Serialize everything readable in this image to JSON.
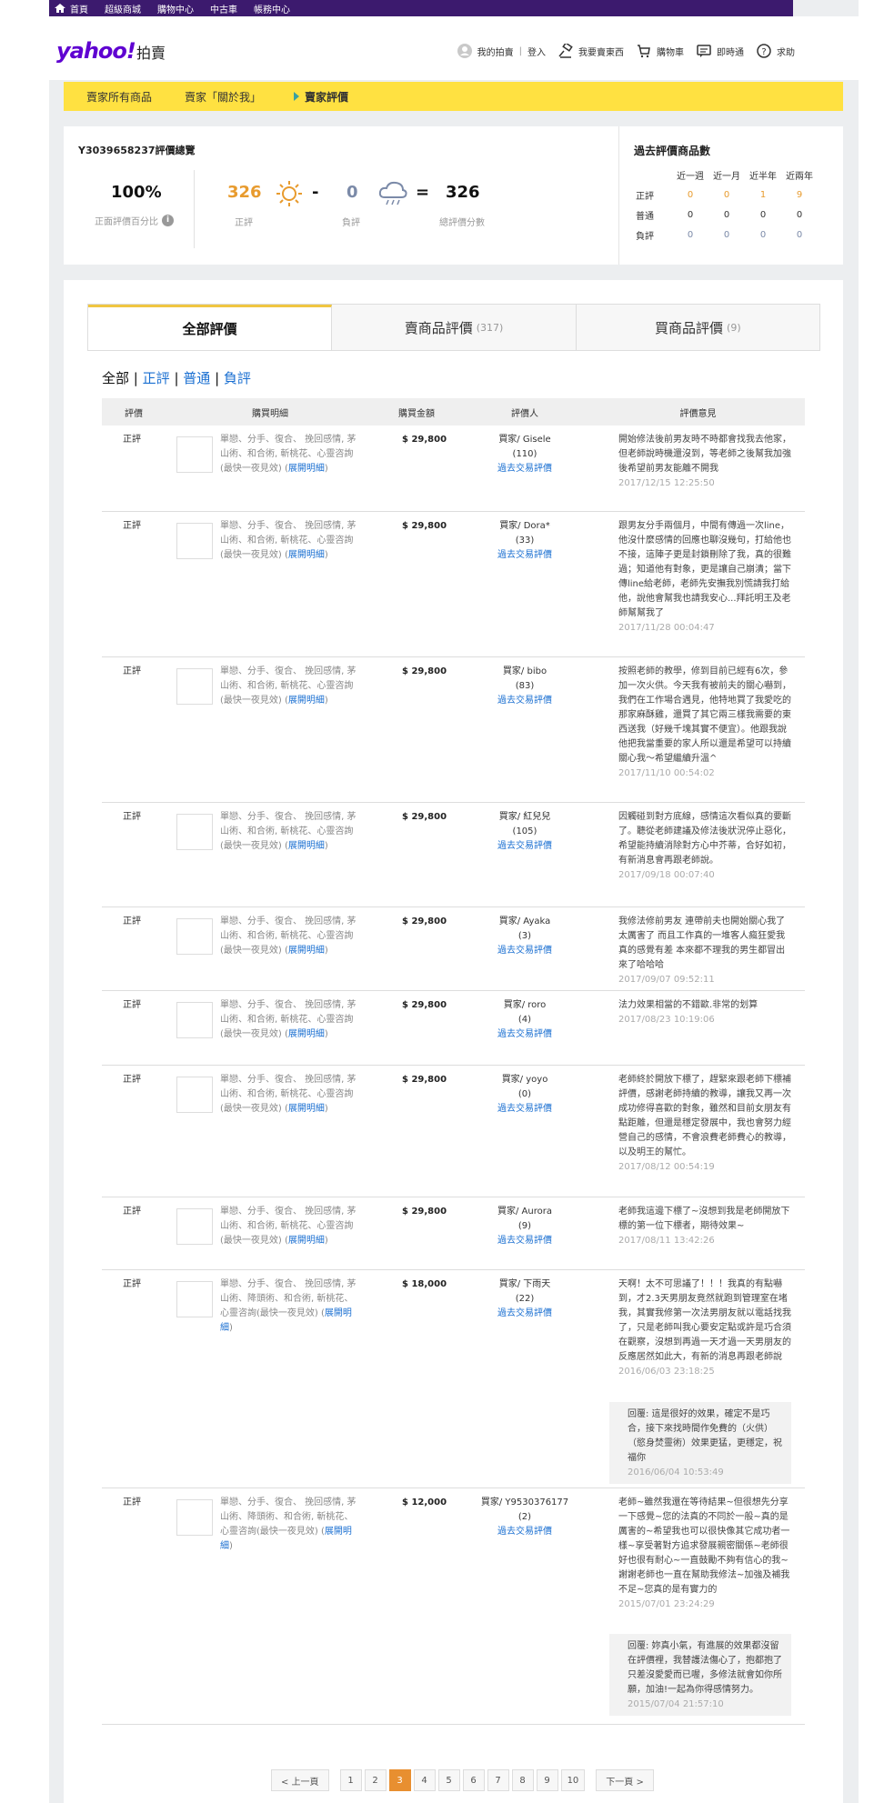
{
  "topbar": {
    "items": [
      "首頁",
      "超級商城",
      "購物中心",
      "中古車",
      "帳務中心"
    ]
  },
  "header": {
    "logo": "yahoo!",
    "logo_sub": "拍賣",
    "links": {
      "my_auction": "我的拍賣",
      "login": "登入",
      "sell": "我要賣東西",
      "cart": "購物車",
      "chat": "即時通",
      "help": "求助"
    }
  },
  "nav": {
    "items": [
      "賣家所有商品",
      "賣家「關於我」",
      "賣家評價"
    ]
  },
  "summary": {
    "title": "Y3039658237評價總覽",
    "percent": "100%",
    "percent_label": "正面評價百分比",
    "positive": "326",
    "positive_label": "正評",
    "negative": "0",
    "negative_label": "負評",
    "total": "326",
    "total_label": "總評價分數",
    "minus": "-",
    "equals": "="
  },
  "past": {
    "title": "過去評價商品數",
    "cols": [
      "近一週",
      "近一月",
      "近半年",
      "近兩年"
    ],
    "rows": [
      {
        "label": "正評",
        "values": [
          "0",
          "0",
          "1",
          "9"
        ]
      },
      {
        "label": "普通",
        "values": [
          "0",
          "0",
          "0",
          "0"
        ]
      },
      {
        "label": "負評",
        "values": [
          "0",
          "0",
          "0",
          "0"
        ]
      }
    ]
  },
  "tabs": [
    {
      "label": "全部評價",
      "count": ""
    },
    {
      "label": "賣商品評價",
      "count": "(317)"
    },
    {
      "label": "買商品評價",
      "count": "(9)"
    }
  ],
  "filter": {
    "all": "全部",
    "positive": "正評",
    "neutral": "普通",
    "negative": "負評",
    "sep": "|"
  },
  "table": {
    "headers": [
      "評價",
      "購買明細",
      "購買金額",
      "評價人",
      "評價意見"
    ],
    "rows": [
      {
        "rating": "正評",
        "desc": "單戀、分手、復合、 挽回感情, 茅山術、和合術, 斬桃花、心靈咨詢(最快一夜見效) (",
        "more": "展開明細",
        "close": ")",
        "price": "$ 29,800",
        "buyer": "買家/ Gisele",
        "buyer_count": "(110)",
        "history": "過去交易評價",
        "comment": "開始修法後前男友時不時都會找我去他家，但老師說時機還沒到，等老師之後幫我加強後希望前男友能離不開我",
        "time": "2017/12/15 12:25:50"
      },
      {
        "rating": "正評",
        "desc": "單戀、分手、復合、 挽回感情, 茅山術、和合術, 斬桃花、心靈咨詢(最快一夜見效) (",
        "more": "展開明細",
        "close": ")",
        "price": "$ 29,800",
        "buyer": "買家/ Dora*",
        "buyer_count": "(33)",
        "history": "過去交易評價",
        "comment": "跟男友分手兩個月，中間有傳過一次line，他沒什麼感情的回應也聊沒幾句，打給他也不接，這陣子更是封鎖刪除了我，真的很難過；知道他有對象，更是讓自己崩潰；當下傳line給老師，老師先安撫我別慌請我打給他，說他會幫我也請我安心...拜託明王及老師幫幫我了",
        "time": "2017/11/28 00:04:47"
      },
      {
        "rating": "正評",
        "desc": "單戀、分手、復合、 挽回感情, 茅山術、和合術, 斬桃花、心靈咨詢(最快一夜見效) (",
        "more": "展開明細",
        "close": ")",
        "price": "$ 29,800",
        "buyer": "買家/ bibo",
        "buyer_count": "(83)",
        "history": "過去交易評價",
        "comment": "按照老師的教學，修到目前已經有6次，參加一次火供。今天我有被前夫的關心嚇到，我們在工作場合遇見，他特地買了我愛吃的那家麻酥雞，還買了其它兩三樣我需要的東西送我（好幾千塊其實不便宜）。他跟我說他把我當重要的家人所以還是希望可以持續關心我～希望繼續升溫^",
        "time": "2017/11/10 00:54:02"
      },
      {
        "rating": "正評",
        "desc": "單戀、分手、復合、 挽回感情, 茅山術、和合術, 斬桃花、心靈咨詢(最快一夜見效) (",
        "more": "展開明細",
        "close": ")",
        "price": "$ 29,800",
        "buyer": "買家/ 紅兒兒",
        "buyer_count": "(105)",
        "history": "過去交易評價",
        "comment": "因觸碰到對方底線，感情這次看似真的要斷了。聽從老師建議及修法後狀況停止惡化，希望能持續消除對方心中芥蒂，合好如初，有新消息會再跟老師說。",
        "time": "2017/09/18 00:07:40"
      },
      {
        "rating": "正評",
        "desc": "單戀、分手、復合、 挽回感情, 茅山術、和合術, 斬桃花、心靈咨詢(最快一夜見效) (",
        "more": "展開明細",
        "close": ")",
        "price": "$ 29,800",
        "buyer": "買家/ Ayaka",
        "buyer_count": "(3)",
        "history": "過去交易評價",
        "comment": "我修法修前男友 連帶前夫也開始關心我了 太厲害了 而且工作真的一堆客人瘋狂愛我 真的感覺有差 本來都不理我的男生都冒出來了哈哈哈",
        "time": "2017/09/07 09:52:11"
      },
      {
        "rating": "正評",
        "desc": "單戀、分手、復合、 挽回感情, 茅山術、和合術, 斬桃花、心靈咨詢(最快一夜見效) (",
        "more": "展開明細",
        "close": ")",
        "price": "$ 29,800",
        "buyer": "買家/ roro",
        "buyer_count": "(4)",
        "history": "過去交易評價",
        "comment": "法力效果相當的不錯歐.非常的划算",
        "time": "2017/08/23 10:19:06"
      },
      {
        "rating": "正評",
        "desc": "單戀、分手、復合、 挽回感情, 茅山術、和合術, 斬桃花、心靈咨詢(最快一夜見效) (",
        "more": "展開明細",
        "close": ")",
        "price": "$ 29,800",
        "buyer": "買家/ yoyo",
        "buyer_count": "(0)",
        "history": "過去交易評價",
        "comment": "老師終於開放下標了，趕緊來跟老師下標補評價，感謝老師持續的教導，讓我又再一次成功修得喜歡的對象，雖然和目前女朋友有點距離，但還是穩定發展中，我也會努力經營自己的感情，不會浪費老師費心的教導，以及明王的幫忙。",
        "time": "2017/08/12 00:54:19"
      },
      {
        "rating": "正評",
        "desc": "單戀、分手、復合、 挽回感情, 茅山術、和合術, 斬桃花、心靈咨詢(最快一夜見效) (",
        "more": "展開明細",
        "close": ")",
        "price": "$ 29,800",
        "buyer": "買家/ Aurora",
        "buyer_count": "(9)",
        "history": "過去交易評價",
        "comment": "老師我這邊下標了~沒想到我是老師開放下標的第一位下標者，期待效果~",
        "time": "2017/08/11 13:42:26"
      },
      {
        "rating": "正評",
        "desc": "單戀、分手、復合、 挽回感情, 茅山術、降頭術、和合術, 斬桃花、心靈咨詢(最快一夜見效) (",
        "more": "展開明細",
        "close": ")",
        "price": "$ 18,000",
        "buyer": "買家/ 下雨天",
        "buyer_count": "(22)",
        "history": "過去交易評價",
        "comment": "天啊！太不可思議了！！！我真的有點嚇到，才2.3天男朋友竟然就跑到管理室在堵我，其實我修第一次法男朋友就以電話找我了，只是老師叫我心要安定點或許是巧合須在觀察，沒想到再過一天才過一天男朋友的反應居然如此大，有新的消息再跟老師說",
        "time": "2016/06/03 23:18:25",
        "reply": "回覆: 這是很好的效果，確定不是巧合，接下來找時間作免費的（火供）（慾身焚靈術）效果更猛，更穩定，祝福你",
        "reply_time": "2016/06/04 10:53:49"
      },
      {
        "rating": "正評",
        "desc": "單戀、分手、復合、 挽回感情, 茅山術、降頭術、和合術, 斬桃花、心靈咨詢(最快一夜見效) (",
        "more": "展開明細",
        "close": ")",
        "price": "$ 12,000",
        "buyer": "買家/ Y9530376177",
        "buyer_count": "(2)",
        "history": "過去交易評價",
        "comment": "老師~雖然我還在等待結果~但很想先分享一下感覺~您的法真的不同於一般~真的是厲害的~希望我也可以很快像其它成功者一樣~享受著對方追求發展親密關係~老師很好也很有耐心~一直鼓勵不夠有信心的我~謝謝老師也一直在幫助我修法~加強及補我不足~您真的是有實力的",
        "time": "2015/07/01 23:24:29",
        "reply": "回覆: 妳真小氣，有進展的效果都沒留在評價裡，我替護法傷心了，抱都抱了只差沒愛愛而已喔，多修法就會如你所願，加油!一起為你得感情努力。",
        "reply_time": "2015/07/04 21:57:10"
      }
    ]
  },
  "pager": {
    "prev": "< 上一頁",
    "pages": [
      "1",
      "2",
      "3",
      "4",
      "5",
      "6",
      "7",
      "8",
      "9",
      "10"
    ],
    "current": "3",
    "next": "下一頁 >"
  },
  "colors": {
    "brand": "#5f01d1",
    "topbar": "#3c1a6e",
    "navbar": "#ffe141",
    "accent": "#e89b2e",
    "link": "#1a6fd1"
  }
}
